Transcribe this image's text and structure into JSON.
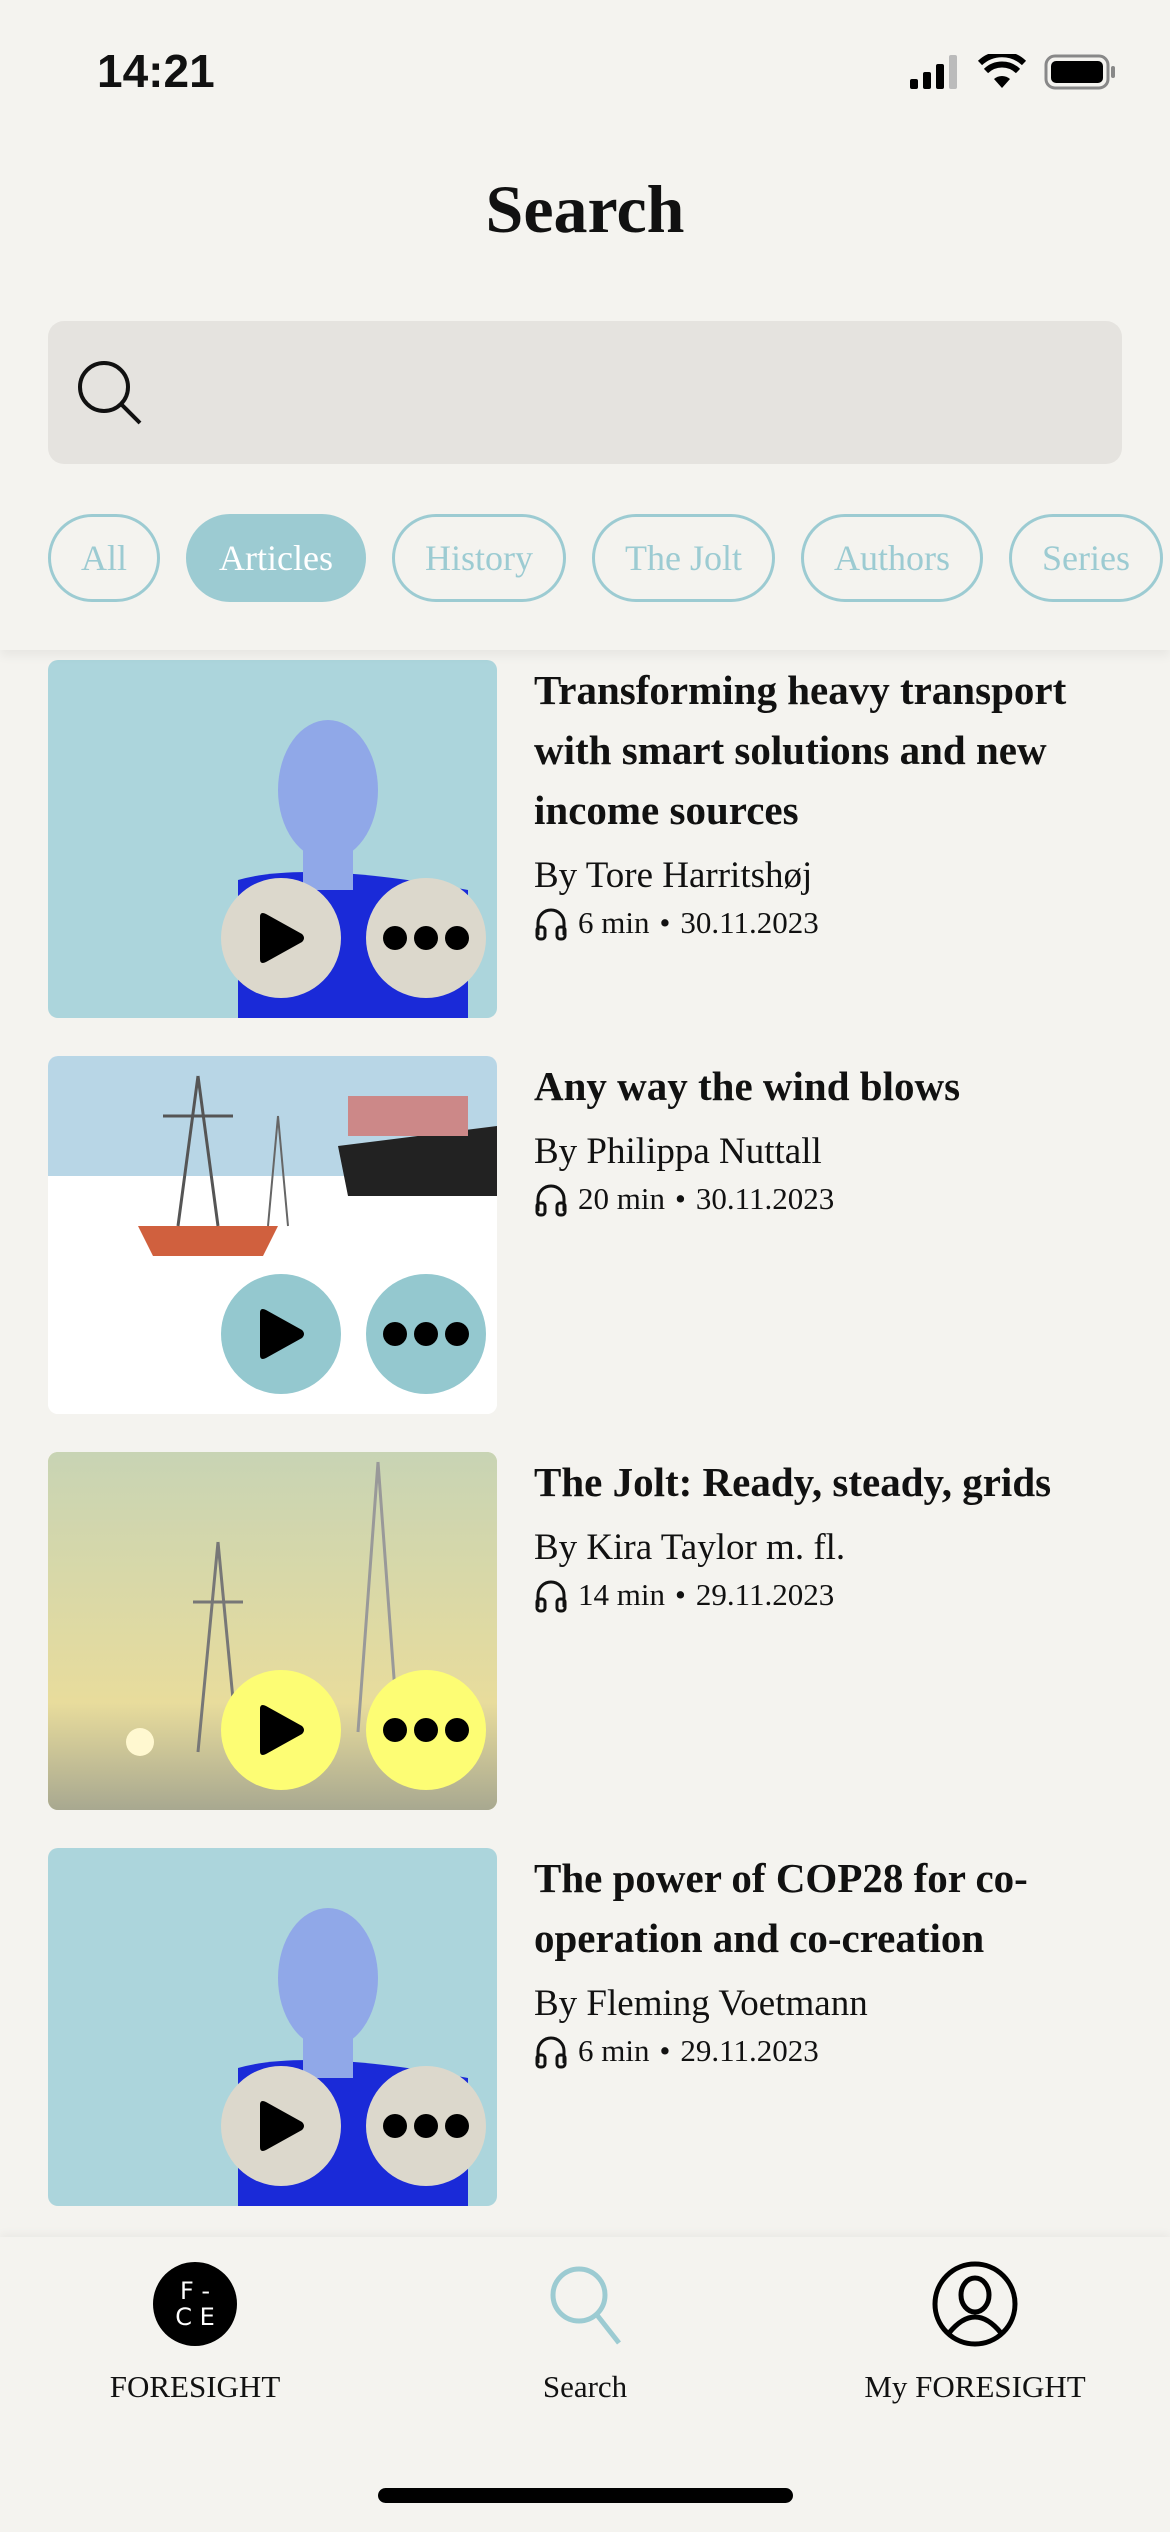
{
  "status": {
    "time": "14:21"
  },
  "header": {
    "title": "Search"
  },
  "search": {
    "placeholder": ""
  },
  "filters": [
    {
      "label": "All",
      "active": false
    },
    {
      "label": "Articles",
      "active": true
    },
    {
      "label": "History",
      "active": false
    },
    {
      "label": "The Jolt",
      "active": false
    },
    {
      "label": "Authors",
      "active": false
    },
    {
      "label": "Series",
      "active": false
    }
  ],
  "articles": [
    {
      "title": "Transforming heavy transport with smart solutions and new income sources",
      "author": "By Tore Harritshøj",
      "duration": "6 min",
      "date": "30.11.2023",
      "image_bg": "#acd5dc",
      "button_color": "#dcd8cc",
      "image": "portrait-illustration"
    },
    {
      "title": "Any way the wind blows",
      "author": "By Philippa Nuttall",
      "duration": "20 min",
      "date": "30.11.2023",
      "image_bg": "#ffffff",
      "button_color": "#94c8cf",
      "image": "ships-illustration"
    },
    {
      "title": "The Jolt: Ready, steady, grids",
      "author": "By Kira Taylor m. fl.",
      "duration": "14 min",
      "date": "29.11.2023",
      "image_bg": "#cfcf9c",
      "button_color": "#fdfd74",
      "image": "power-lines-photo"
    },
    {
      "title": "The power of COP28 for co-operation and co-creation",
      "author": "By Fleming Voetmann",
      "duration": "6 min",
      "date": "29.11.2023",
      "image_bg": "#acd5dc",
      "button_color": "#dcd8cc",
      "image": "portrait-illustration"
    }
  ],
  "meta_separator": "•",
  "tabs": [
    {
      "label": "FORESIGHT",
      "logo": "F-CE"
    },
    {
      "label": "Search"
    },
    {
      "label": "My FORESIGHT"
    }
  ],
  "colors": {
    "accent": "#9ccbd2",
    "background": "#f4f3ef"
  }
}
